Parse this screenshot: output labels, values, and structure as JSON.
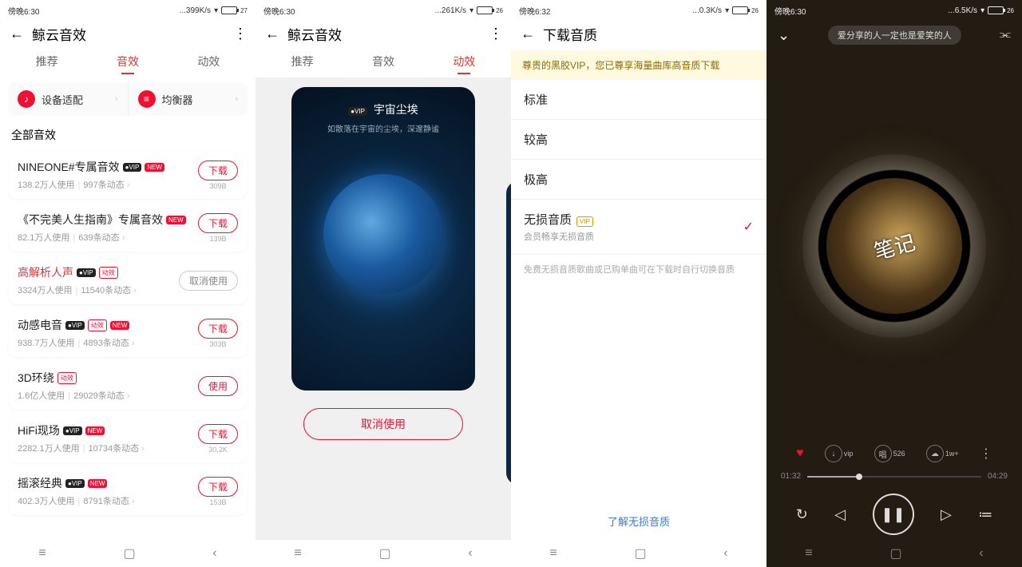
{
  "panel1": {
    "status": {
      "time": "傍晚6:30",
      "net": "...399K/s",
      "batt": "27"
    },
    "title": "鲸云音效",
    "tabs": {
      "recommend": "推荐",
      "sound": "音效",
      "motion": "动效"
    },
    "tool": {
      "device": "设备适配",
      "eq": "均衡器"
    },
    "section": "全部音效",
    "btn_download": "下载",
    "btn_use": "使用",
    "btn_cancel_use": "取消使用",
    "effects": [
      {
        "name": "NINEONE#专属音效",
        "badges": [
          "vip",
          "new"
        ],
        "meta_users": "138.2万人使用",
        "meta_posts": "997条动态",
        "action": "download",
        "size": "309B"
      },
      {
        "name": "《不完美人生指南》专属音效",
        "badges": [
          "new"
        ],
        "meta_users": "82.1万人使用",
        "meta_posts": "639条动态",
        "action": "download",
        "size": "139B"
      },
      {
        "name": "高解析人声",
        "badges": [
          "vip",
          "fx"
        ],
        "red": true,
        "meta_users": "3324万人使用",
        "meta_posts": "11540条动态",
        "action": "cancel",
        "size": ""
      },
      {
        "name": "动感电音",
        "badges": [
          "vip",
          "fx",
          "new"
        ],
        "meta_users": "938.7万人使用",
        "meta_posts": "4893条动态",
        "action": "download",
        "size": "303B"
      },
      {
        "name": "3D环绕",
        "badges": [
          "fx"
        ],
        "meta_users": "1.6亿人使用",
        "meta_posts": "29029条动态",
        "action": "use",
        "size": ""
      },
      {
        "name": "HiFi现场",
        "badges": [
          "vip",
          "new"
        ],
        "meta_users": "2282.1万人使用",
        "meta_posts": "10734条动态",
        "action": "download",
        "size": "30.2K"
      },
      {
        "name": "摇滚经典",
        "badges": [
          "vip",
          "new"
        ],
        "meta_users": "402.3万人使用",
        "meta_posts": "8791条动态",
        "action": "download",
        "size": "153B"
      }
    ]
  },
  "panel2": {
    "status": {
      "time": "傍晚6:30",
      "net": "...261K/s",
      "batt": "26"
    },
    "title": "鲸云音效",
    "tabs": {
      "recommend": "推荐",
      "sound": "音效",
      "motion": "动效"
    },
    "theme_title": "宇宙尘埃",
    "theme_sub": "如散落在宇宙的尘埃，深邃静谧",
    "cancel": "取消使用"
  },
  "panel3": {
    "status": {
      "time": "傍晚6:32",
      "net": "...0.3K/s",
      "batt": "26"
    },
    "title": "下载音质",
    "notice": "尊贵的黑胶VIP，您已尊享海量曲库高音质下载",
    "options": [
      {
        "label": "标准"
      },
      {
        "label": "较高"
      },
      {
        "label": "极高"
      },
      {
        "label": "无损音质",
        "sub": "会员畅享无损音质",
        "vip": true,
        "selected": true
      }
    ],
    "footnote": "免费无损音质歌曲或已购单曲可在下载时自行切换音质",
    "learn": "了解无损音质"
  },
  "panel4": {
    "status": {
      "time": "傍晚6:30",
      "net": "...6.5K/s",
      "batt": "26"
    },
    "song_pill": "爱分享的人一定也是爱笑的人",
    "counts": {
      "sing": "526",
      "comment": "1w+"
    },
    "time_cur": "01:32",
    "time_total": "04:29"
  },
  "badge_text": {
    "vip": "●VIP",
    "new": "NEW",
    "fx": "动效",
    "vip2": "VIP"
  }
}
